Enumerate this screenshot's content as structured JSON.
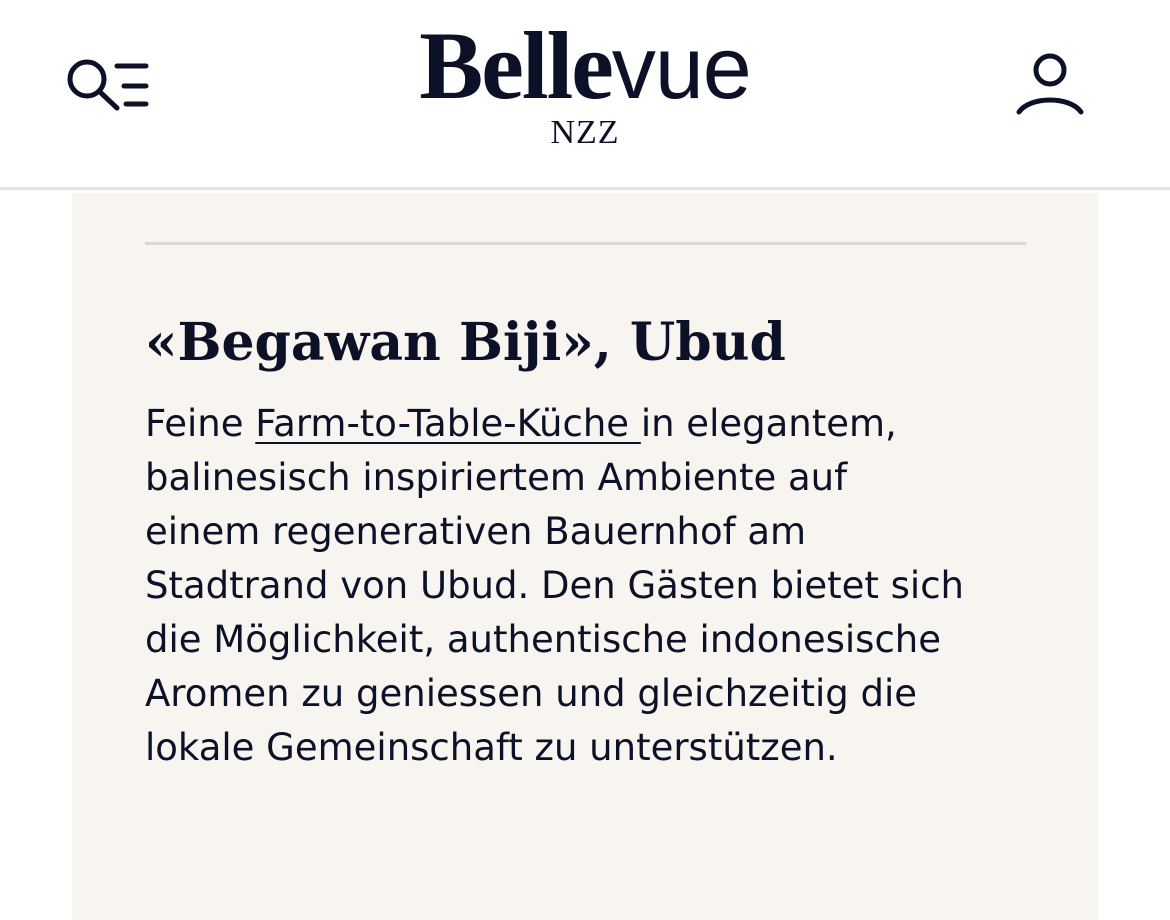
{
  "header": {
    "logo": {
      "belle": "Belle",
      "vue": "vue",
      "publisher": "NZZ"
    },
    "menu_search_icon": "menu-search-icon",
    "account_icon": "user-icon"
  },
  "article": {
    "title": "«Begawan Biji», Ubud",
    "description": {
      "line1_prefix": "Feine ",
      "link_text": "Farm-to-Table-Küche ",
      "line1_suffix": "in elegantem,",
      "line2": "balinesisch inspiriertem Ambiente auf",
      "line3": "einem regenerativen Bauernhof am",
      "line4": "Stadtrand von Ubud. Den Gästen bietet sich",
      "line5": "die Möglichkeit, authentische indonesische",
      "line6": "Aromen zu geniessen und gleichzeitig die",
      "line7": "lokale Gemeinschaft zu unterstützen."
    }
  },
  "colors": {
    "ink": "#0c1128",
    "card_background": "#f8f5f0",
    "divider": "#d9d8d5",
    "header_border": "#e4e4e4"
  }
}
